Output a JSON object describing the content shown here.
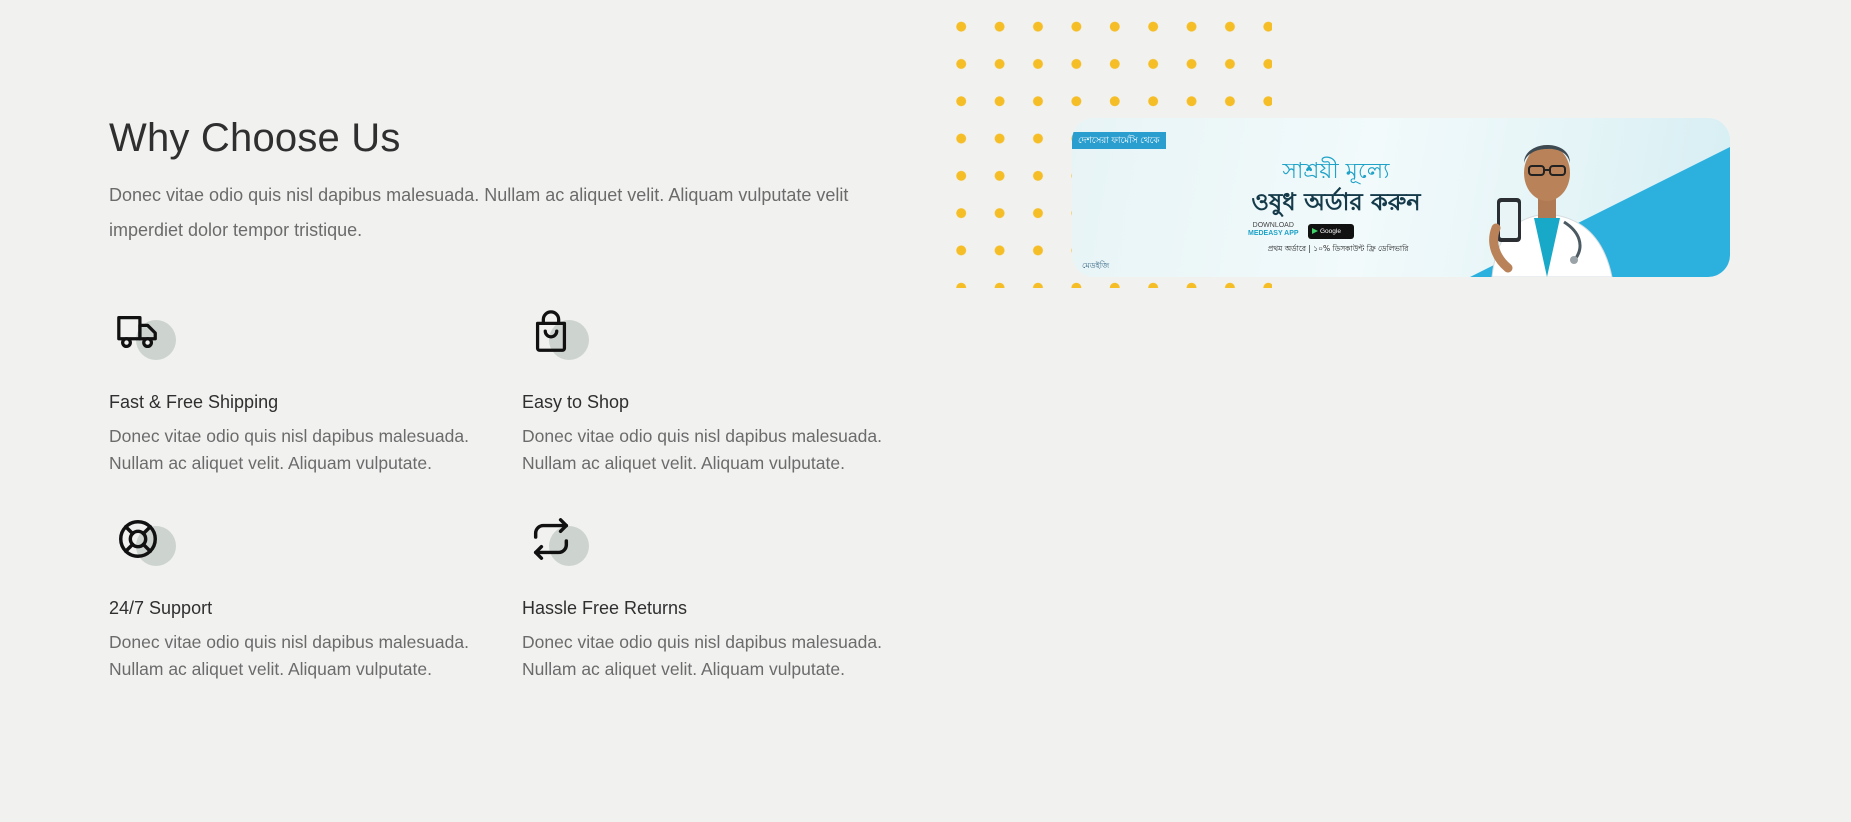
{
  "section": {
    "title": "Why Choose Us",
    "intro": "Donec vitae odio quis nisl dapibus malesuada. Nullam ac aliquet velit. Aliquam vulputate velit imperdiet dolor tempor tristique."
  },
  "features": [
    {
      "icon": "truck-icon",
      "title": "Fast & Free Shipping",
      "description": "Donec vitae odio quis nisl dapibus malesuada. Nullam ac aliquet velit. Aliquam vulputate."
    },
    {
      "icon": "shopping-bag-icon",
      "title": "Easy to Shop",
      "description": "Donec vitae odio quis nisl dapibus malesuada. Nullam ac aliquet velit. Aliquam vulputate."
    },
    {
      "icon": "lifebuoy-icon",
      "title": "24/7 Support",
      "description": "Donec vitae odio quis nisl dapibus malesuada. Nullam ac aliquet velit. Aliquam vulputate."
    },
    {
      "icon": "repeat-icon",
      "title": "Hassle Free Returns",
      "description": "Donec vitae odio quis nisl dapibus malesuada. Nullam ac aliquet velit. Aliquam vulputate."
    }
  ],
  "banner": {
    "tag": "দেশসেরা ফার্মেসি থেকে",
    "line1": "সাশ্রয়ী মূল্যে",
    "line2": "ওষুধ অর্ডার করুন",
    "download_label": "DOWNLOAD",
    "app_label": "MEDEASY APP",
    "store_label": "Google Play",
    "offer": "প্রথম অর্ডারে | ১০% ডিসকাউন্ট ফ্রি ডেলিভারি",
    "logo_text": "মেডইজি"
  },
  "colors": {
    "background": "#f1f2f0",
    "heading": "#2f2f2f",
    "body_text": "#6b6b6b",
    "icon_bubble": "#cdd3cf",
    "dot_accent": "#f5bd26",
    "banner_accent": "#2cb0de"
  }
}
